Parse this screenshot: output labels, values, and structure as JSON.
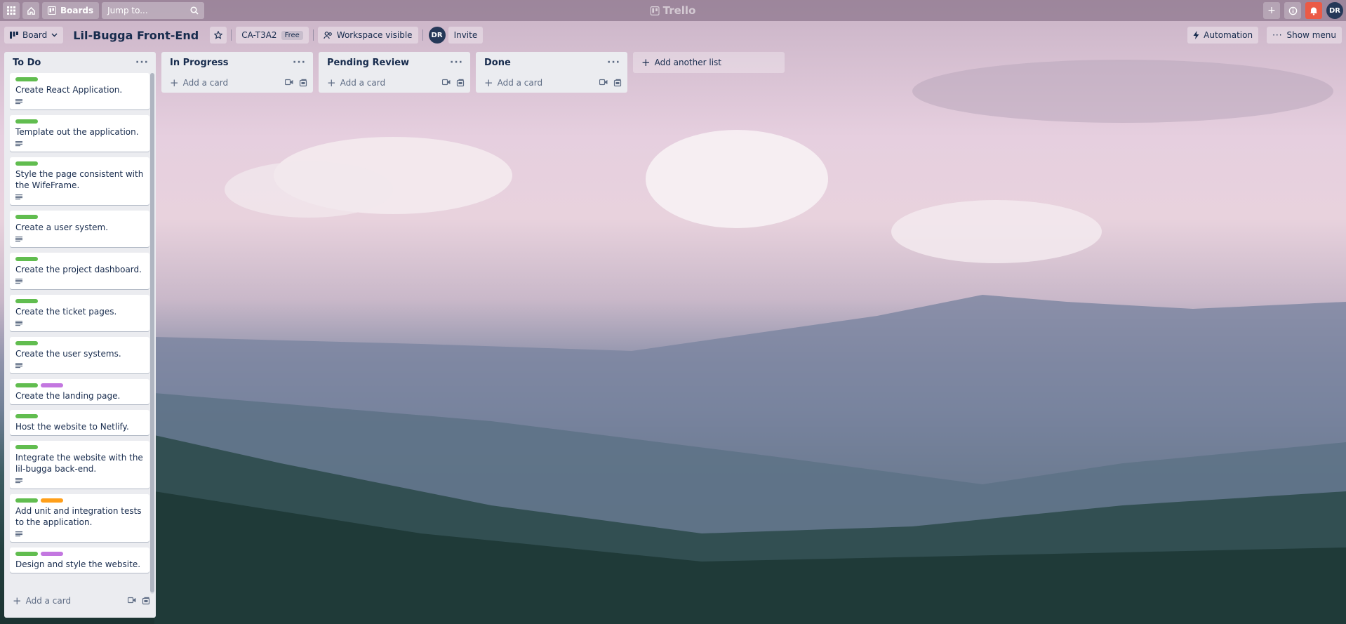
{
  "topbar": {
    "boards_label": "Boards",
    "search_placeholder": "Jump to...",
    "logo": "Trello",
    "avatar_initials": "DR"
  },
  "header": {
    "view_label": "Board",
    "board_title": "Lil-Bugga Front-End",
    "workspace_name": "CA-T3A2",
    "plan_badge": "Free",
    "visibility_label": "Workspace visible",
    "member_initials": "DR",
    "invite_label": "Invite",
    "automation_label": "Automation",
    "show_menu_label": "Show menu"
  },
  "lists": [
    {
      "title": "To Do",
      "add_card_label": "Add a card",
      "cards": [
        {
          "title": "Create React Application.",
          "labels": [
            "green"
          ],
          "has_description": true
        },
        {
          "title": "Template out the application.",
          "labels": [
            "green"
          ],
          "has_description": true
        },
        {
          "title": "Style the page consistent with the WifeFrame.",
          "labels": [
            "green"
          ],
          "has_description": true
        },
        {
          "title": "Create a user system.",
          "labels": [
            "green"
          ],
          "has_description": true
        },
        {
          "title": "Create the project dashboard.",
          "labels": [
            "green"
          ],
          "has_description": true
        },
        {
          "title": "Create the ticket pages.",
          "labels": [
            "green"
          ],
          "has_description": true
        },
        {
          "title": "Create the user systems.",
          "labels": [
            "green"
          ],
          "has_description": true
        },
        {
          "title": "Create the landing page.",
          "labels": [
            "green",
            "purple"
          ],
          "has_description": false
        },
        {
          "title": "Host the website to Netlify.",
          "labels": [
            "green"
          ],
          "has_description": false
        },
        {
          "title": "Integrate the website with the lil-bugga back-end.",
          "labels": [
            "green"
          ],
          "has_description": true
        },
        {
          "title": "Add unit and integration tests to the application.",
          "labels": [
            "green",
            "orange"
          ],
          "has_description": true
        },
        {
          "title": "Design and style the website.",
          "labels": [
            "green",
            "purple"
          ],
          "has_description": false
        }
      ]
    },
    {
      "title": "In Progress",
      "add_card_label": "Add a card",
      "cards": []
    },
    {
      "title": "Pending Review",
      "add_card_label": "Add a card",
      "cards": []
    },
    {
      "title": "Done",
      "add_card_label": "Add a card",
      "cards": []
    }
  ],
  "add_list_label": "Add another list",
  "colors": {
    "label_green": "#61bd4f",
    "label_purple": "#c377e0",
    "label_orange": "#ff9f1a",
    "notification": "#eb5a46"
  }
}
